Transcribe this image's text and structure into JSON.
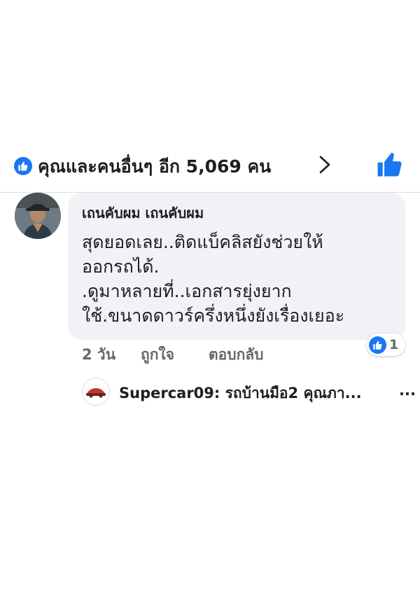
{
  "reactions": {
    "icon": "like-icon",
    "summary": "คุณและคนอื่นๆ อีก 5,069 คน",
    "chevron_icon": "chevron-right-icon",
    "like_button_icon": "thumbs-up-icon",
    "accent_color": "#1877f2"
  },
  "comment": {
    "author": "เถนคับผม เถนคับผม",
    "lines": [
      "สุดยอดเลย..ติดแบ็คลิสยังช่วยให้",
      "ออกรถได้.",
      ".ดูมาหลายที่..เอกสารยุ่งยาก",
      "ใช้.ขนาดดาวร์ครึ่งหนึ่งยังเรื่องเยอะ"
    ],
    "time": "2 วัน",
    "like_action": "ถูกใจ",
    "reply_action": "ตอบกลับ",
    "like_count": "1"
  },
  "reply": {
    "preview": "Supercar09: รถบ้านมือ2 คุณภา...",
    "more": "..."
  }
}
